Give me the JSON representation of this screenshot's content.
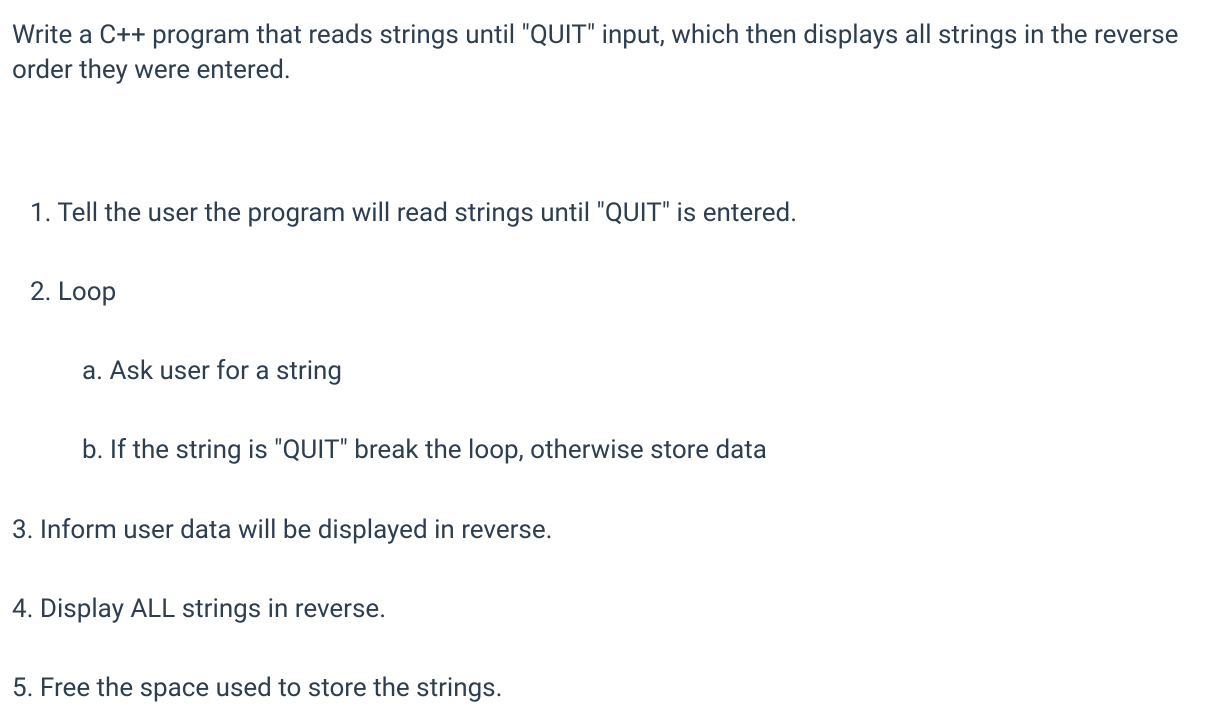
{
  "intro": "Write a C++ program that reads strings until \"QUIT\" input, which then displays all strings in the reverse order they were entered.",
  "steps": {
    "one": "1. Tell the user the program will read strings until \"QUIT\" is entered.",
    "two": "2. Loop",
    "two_a": "a. Ask user for a string",
    "two_b": "b. If the string is \"QUIT\" break the loop, otherwise store data",
    "three": "3. Inform user data will be displayed in reverse.",
    "four": "4. Display ALL strings in reverse.",
    "five": "5. Free the space used to store the strings."
  }
}
